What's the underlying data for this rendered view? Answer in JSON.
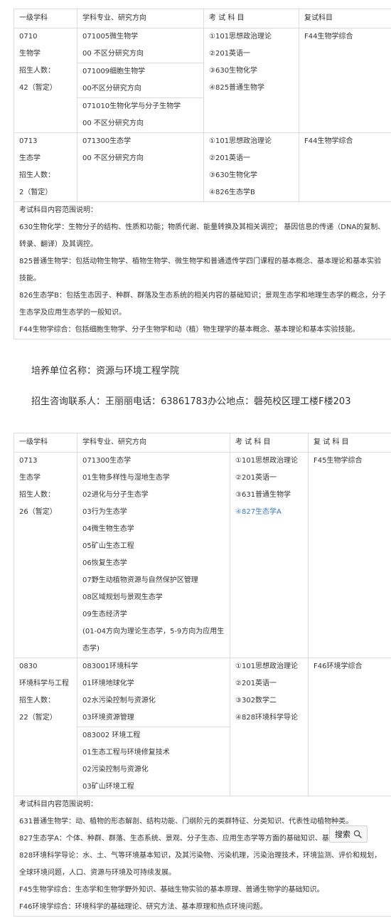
{
  "table1": {
    "headers": [
      "一级学科",
      "学科专业、研究方向",
      "考 试 科 目",
      "复试科目"
    ],
    "row1": {
      "code": "0710",
      "name": "生物学",
      "enroll_label": "招生人数：",
      "enroll": "42（暂定）",
      "majors": [
        [
          "071005微生物学",
          "00 不区分研究方向"
        ],
        [
          "071009细胞生物学",
          "00不区分研究方向"
        ],
        [
          "071010生物化学与分子生物学",
          "00 不区分研究方向"
        ]
      ],
      "exams": [
        "①101思想政治理论",
        "②201英语一",
        "③630生物化学",
        "④825普通生物学"
      ],
      "retest": "F44生物学综合"
    },
    "row2": {
      "code": "0713",
      "name": "生态学",
      "enroll_label": "招生人数：",
      "enroll": "2（暂定）",
      "majors": [
        [
          "071300生态学",
          "00 不区分研究方向"
        ]
      ],
      "exams": [
        "①101思想政治理论",
        "②201英语一",
        "③630生物化学",
        "④826生态学B"
      ],
      "retest": "F44生物学综合"
    },
    "notes": [
      "考试科目内容范围说明：",
      "630生物化学：生物分子的结构、性质和功能；物质代谢、能量转换及其相关调控； 基因信息的传递（DNA的复制、转录、翻译）及其调控。",
      "825普通生物学：包括动物生物学、植物生物学、微生物学和普通遗传学四门课程的基本概念、基本理论和基本实验技能。",
      "826生态学B：包括生态因子、种群、群落及生态系统的相关内容的基础知识；景观生态学和地理生态学的概念，分子生态学及应用生态学的一般知识。",
      "F44生物学综合：包括细胞生物学、分子生物学和动（植）物生理学的基本概念、基本理论和基本实验技能。"
    ]
  },
  "unit": {
    "name": "培养单位名称：资源与环境工程学院",
    "contact": "招生咨询联系人：王丽丽电话：63861783办公地点：磬苑校区理工楼F楼203"
  },
  "table2": {
    "headers": [
      "一级学科",
      "学科专业、研究方向",
      "考 试 科 目",
      "复 试 科 目"
    ],
    "row1": {
      "code": "0713",
      "name": "生态学",
      "enroll_label": "招生人数：",
      "enroll": "26（暂定）",
      "majors": [
        "071300生态学",
        "01生物多样性与湿地生态学",
        "02进化与分子生态学",
        "03行为生态学",
        "04微生物生态学",
        "05矿山生态工程",
        "06恢复生态学",
        "07野生动植物资源与自然保护区管理",
        "08区域规划与景观生态学",
        "09生态经济学",
        "(01-04方向为理论生态学，5-9方向为应用生态学)"
      ],
      "exams": [
        "①101思想政治理论",
        "②201英语一",
        "③631普通生物学"
      ],
      "exam_link_prefix": "④",
      "exam_link": "827生态学A",
      "retest": "F45生物学综合"
    },
    "row2": {
      "code": "0830",
      "name": "环境科学与工程",
      "enroll_label": "招生人数：",
      "enroll": "22（暂定）",
      "majors_a": [
        "083001环境科学",
        "01环境地球化学",
        "02水污染控制与资源化",
        "03环境资源管理"
      ],
      "majors_b": [
        "083002 环境工程",
        "01生态工程与环境修复技术",
        "02污染控制与资源化",
        "03矿山环境工程"
      ],
      "exams": [
        "①101思想政治理论",
        "②201英语一",
        "③302数学二",
        "④828环境科学导论"
      ],
      "retest": "F46环境学综合"
    },
    "notes": [
      "考试科目内容范围说明：",
      "631普通生物学：动、植物的形态解剖、结构功能、门纲阶元的类群特征、分类知识、代表性动植物种类。",
      "827生态学A：个体、种群、群落、生态系统、景观、分子生态、应用生态学等方面的基础知识、基本原理",
      "828环境科学导论：水、土、气等环境基本知识，及其污染物、污染机理，污染治理技术，环境监测、评价和规划，全球环境问题，人口、资源与环境及可持续发展。",
      "F45生物学综合：生态学和生物学野外知识、基础生物实验的基本原理、普通生物学的基础知识。",
      "F46环境学综合：环境科学的基础理论、研究方法、基本原理和热点环境问题。"
    ]
  },
  "search": {
    "label": "搜索",
    "icon": "search-icon"
  }
}
